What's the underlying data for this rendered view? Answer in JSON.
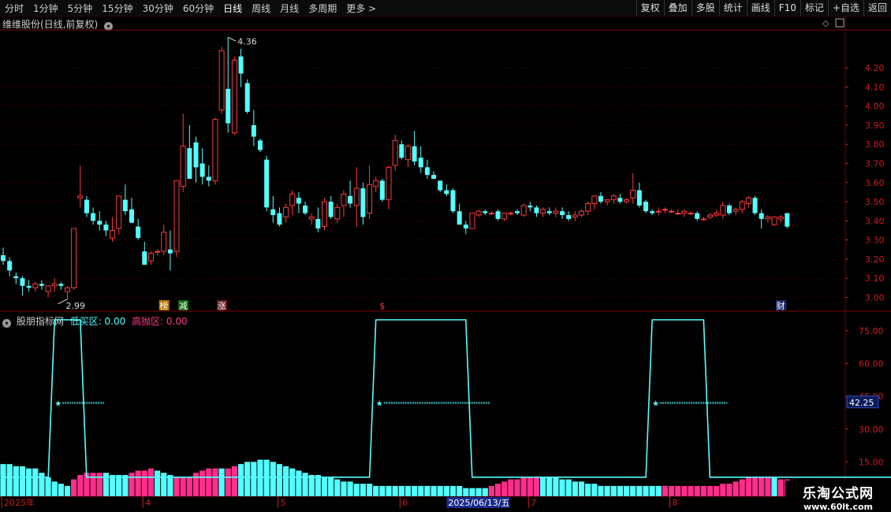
{
  "toolbar": {
    "timeframes": [
      "分时",
      "1分钟",
      "5分钟",
      "15分钟",
      "30分钟",
      "60分钟",
      "日线",
      "周线",
      "月线",
      "多周期",
      "更多 >"
    ],
    "active_timeframe": "日线",
    "right_buttons": [
      "复权",
      "叠加",
      "多股",
      "统计",
      "画线",
      "F10",
      "标记",
      "+自选",
      "返回"
    ]
  },
  "main_panel": {
    "title": "维维股份(日线,前复权)"
  },
  "indicator_panel": {
    "name": "股朋指标网",
    "low_label": "低买区: 0.00",
    "high_label": "高抛区: 0.00"
  },
  "watermark": {
    "title": "乐淘公式网",
    "url": "www.60lt.com"
  },
  "colors": {
    "up": "#ff3a3a",
    "down": "#54ffff",
    "bg": "#000000",
    "grid": "#7a0000",
    "axis_text": "#c8201e",
    "line": "#54ffff",
    "bar_pink": "#ff2e8a",
    "bar_cyan": "#54ffff"
  },
  "chart_data": [
    {
      "type": "candlestick",
      "y_ticks": [
        "4.20",
        "4.10",
        "4.00",
        "3.90",
        "3.80",
        "3.70",
        "3.60",
        "3.50",
        "3.40",
        "3.30",
        "3.20",
        "3.10",
        "3.00"
      ],
      "ylim": [
        2.94,
        4.39
      ],
      "annotations": {
        "high": "4.36",
        "low": "2.99"
      },
      "event_markers": [
        "榜",
        "减",
        "涨",
        "$",
        "财"
      ],
      "ohlc": [
        [
          3.22,
          3.26,
          3.17,
          3.19
        ],
        [
          3.19,
          3.21,
          3.11,
          3.14
        ],
        [
          3.11,
          3.13,
          3.07,
          3.1
        ],
        [
          3.1,
          3.11,
          3.01,
          3.06
        ],
        [
          3.06,
          3.09,
          3.03,
          3.05
        ],
        [
          3.05,
          3.08,
          3.03,
          3.07
        ],
        [
          3.07,
          3.09,
          3.04,
          3.06
        ],
        [
          3.03,
          3.06,
          3.0,
          3.06
        ],
        [
          3.06,
          3.1,
          3.03,
          3.07
        ],
        [
          3.07,
          3.08,
          3.04,
          3.06
        ],
        [
          3.03,
          3.06,
          2.99,
          3.05
        ],
        [
          3.05,
          3.36,
          3.04,
          3.36
        ],
        [
          3.52,
          3.69,
          3.47,
          3.53
        ],
        [
          3.51,
          3.53,
          3.42,
          3.44
        ],
        [
          3.44,
          3.47,
          3.38,
          3.4
        ],
        [
          3.4,
          3.45,
          3.35,
          3.38
        ],
        [
          3.38,
          3.4,
          3.32,
          3.35
        ],
        [
          3.31,
          3.42,
          3.29,
          3.35
        ],
        [
          3.36,
          3.53,
          3.33,
          3.53
        ],
        [
          3.51,
          3.59,
          3.43,
          3.45
        ],
        [
          3.46,
          3.52,
          3.39,
          3.39
        ],
        [
          3.37,
          3.41,
          3.3,
          3.31
        ],
        [
          3.24,
          3.29,
          3.18,
          3.17
        ],
        [
          3.19,
          3.24,
          3.17,
          3.23
        ],
        [
          3.24,
          3.25,
          3.22,
          3.24
        ],
        [
          3.24,
          3.38,
          3.22,
          3.34
        ],
        [
          3.25,
          3.35,
          3.14,
          3.23
        ],
        [
          3.24,
          3.61,
          3.21,
          3.61
        ],
        [
          3.58,
          3.96,
          3.55,
          3.79
        ],
        [
          3.78,
          3.9,
          3.62,
          3.62
        ],
        [
          3.81,
          3.84,
          3.6,
          3.68
        ],
        [
          3.7,
          3.78,
          3.59,
          3.63
        ],
        [
          3.63,
          3.69,
          3.58,
          3.61
        ],
        [
          3.61,
          3.94,
          3.59,
          3.93
        ],
        [
          3.98,
          4.31,
          3.96,
          4.29
        ],
        [
          4.09,
          4.36,
          3.86,
          3.91
        ],
        [
          3.86,
          4.26,
          3.85,
          4.24
        ],
        [
          4.26,
          4.3,
          4.1,
          4.17
        ],
        [
          4.12,
          4.14,
          3.96,
          3.97
        ],
        [
          3.9,
          3.98,
          3.79,
          3.84
        ],
        [
          3.82,
          3.83,
          3.76,
          3.77
        ],
        [
          3.72,
          3.74,
          3.45,
          3.47
        ],
        [
          3.46,
          3.53,
          3.39,
          3.43
        ],
        [
          3.44,
          3.47,
          3.37,
          3.38
        ],
        [
          3.42,
          3.49,
          3.39,
          3.47
        ],
        [
          3.48,
          3.56,
          3.43,
          3.54
        ],
        [
          3.52,
          3.55,
          3.44,
          3.49
        ],
        [
          3.48,
          3.5,
          3.43,
          3.44
        ],
        [
          3.41,
          3.44,
          3.38,
          3.42
        ],
        [
          3.41,
          3.47,
          3.34,
          3.36
        ],
        [
          3.37,
          3.52,
          3.35,
          3.5
        ],
        [
          3.5,
          3.53,
          3.41,
          3.42
        ],
        [
          3.41,
          3.49,
          3.39,
          3.47
        ],
        [
          3.48,
          3.56,
          3.42,
          3.54
        ],
        [
          3.53,
          3.61,
          3.47,
          3.49
        ],
        [
          3.48,
          3.68,
          3.37,
          3.57
        ],
        [
          3.57,
          3.6,
          3.38,
          3.42
        ],
        [
          3.44,
          3.69,
          3.41,
          3.59
        ],
        [
          3.58,
          3.63,
          3.55,
          3.61
        ],
        [
          3.61,
          3.62,
          3.5,
          3.51
        ],
        [
          3.51,
          3.69,
          3.46,
          3.68
        ],
        [
          3.69,
          3.85,
          3.66,
          3.82
        ],
        [
          3.8,
          3.82,
          3.72,
          3.73
        ],
        [
          3.72,
          3.8,
          3.68,
          3.79
        ],
        [
          3.79,
          3.87,
          3.69,
          3.71
        ],
        [
          3.73,
          3.79,
          3.65,
          3.68
        ],
        [
          3.68,
          3.72,
          3.62,
          3.64
        ],
        [
          3.64,
          3.66,
          3.62,
          3.62
        ],
        [
          3.61,
          3.61,
          3.55,
          3.56
        ],
        [
          3.56,
          3.59,
          3.53,
          3.54
        ],
        [
          3.56,
          3.57,
          3.44,
          3.45
        ],
        [
          3.45,
          3.49,
          3.38,
          3.38
        ],
        [
          3.38,
          3.4,
          3.33,
          3.36
        ],
        [
          3.36,
          3.44,
          3.36,
          3.44
        ],
        [
          3.43,
          3.46,
          3.42,
          3.45
        ],
        [
          3.45,
          3.46,
          3.43,
          3.44
        ],
        [
          3.44,
          3.45,
          3.43,
          3.44
        ],
        [
          3.45,
          3.46,
          3.4,
          3.41
        ],
        [
          3.41,
          3.44,
          3.4,
          3.44
        ],
        [
          3.44,
          3.45,
          3.43,
          3.44
        ],
        [
          3.45,
          3.46,
          3.43,
          3.44
        ],
        [
          3.43,
          3.49,
          3.42,
          3.48
        ],
        [
          3.48,
          3.5,
          3.45,
          3.47
        ],
        [
          3.47,
          3.48,
          3.42,
          3.44
        ],
        [
          3.44,
          3.47,
          3.42,
          3.46
        ],
        [
          3.45,
          3.47,
          3.43,
          3.44
        ],
        [
          3.44,
          3.47,
          3.42,
          3.45
        ],
        [
          3.45,
          3.47,
          3.41,
          3.43
        ],
        [
          3.43,
          3.45,
          3.4,
          3.41
        ],
        [
          3.42,
          3.45,
          3.4,
          3.43
        ],
        [
          3.43,
          3.46,
          3.42,
          3.45
        ],
        [
          3.45,
          3.5,
          3.43,
          3.49
        ],
        [
          3.49,
          3.53,
          3.46,
          3.53
        ],
        [
          3.53,
          3.55,
          3.49,
          3.5
        ],
        [
          3.5,
          3.51,
          3.48,
          3.51
        ],
        [
          3.51,
          3.54,
          3.49,
          3.53
        ],
        [
          3.52,
          3.54,
          3.49,
          3.5
        ],
        [
          3.5,
          3.52,
          3.49,
          3.51
        ],
        [
          3.52,
          3.65,
          3.49,
          3.56
        ],
        [
          3.56,
          3.6,
          3.47,
          3.48
        ],
        [
          3.5,
          3.51,
          3.44,
          3.45
        ],
        [
          3.45,
          3.46,
          3.43,
          3.44
        ],
        [
          3.45,
          3.47,
          3.43,
          3.45
        ],
        [
          3.46,
          3.47,
          3.44,
          3.46
        ],
        [
          3.45,
          3.46,
          3.44,
          3.45
        ],
        [
          3.44,
          3.46,
          3.43,
          3.44
        ],
        [
          3.44,
          3.46,
          3.42,
          3.45
        ],
        [
          3.44,
          3.45,
          3.43,
          3.44
        ],
        [
          3.44,
          3.45,
          3.4,
          3.41
        ],
        [
          3.41,
          3.42,
          3.4,
          3.41
        ],
        [
          3.42,
          3.44,
          3.41,
          3.43
        ],
        [
          3.43,
          3.46,
          3.42,
          3.44
        ],
        [
          3.43,
          3.5,
          3.41,
          3.48
        ],
        [
          3.48,
          3.49,
          3.43,
          3.44
        ],
        [
          3.45,
          3.47,
          3.43,
          3.46
        ],
        [
          3.46,
          3.51,
          3.44,
          3.5
        ],
        [
          3.49,
          3.53,
          3.47,
          3.52
        ],
        [
          3.52,
          3.53,
          3.43,
          3.44
        ],
        [
          3.44,
          3.46,
          3.36,
          3.41
        ],
        [
          3.41,
          3.43,
          3.39,
          3.42
        ],
        [
          3.38,
          3.42,
          3.37,
          3.42
        ],
        [
          3.41,
          3.43,
          3.39,
          3.42
        ],
        [
          3.44,
          3.44,
          3.36,
          3.37
        ]
      ]
    },
    {
      "type": "line+bar",
      "y_ticks": [
        "75.00",
        "60.00",
        "45.00",
        "30.00",
        "15.00"
      ],
      "ylim": [
        0,
        80
      ],
      "current_value": "42.25",
      "line_plateau": 80,
      "line_floor": 8,
      "star_label_level": 42,
      "plateaus": [
        [
          8,
          12
        ],
        [
          58,
          72
        ],
        [
          101,
          109
        ],
        [
          145,
          155
        ]
      ],
      "bars": [
        14,
        14,
        13,
        13,
        12,
        12,
        10,
        8,
        6,
        5,
        4,
        7,
        9,
        10,
        10,
        10,
        10,
        9,
        9,
        9,
        10,
        11,
        11,
        12,
        11,
        10,
        9,
        8,
        8,
        8,
        10,
        11,
        12,
        12,
        12,
        12,
        13,
        14,
        15,
        15,
        16,
        16,
        15,
        14,
        13,
        12,
        11,
        10,
        9,
        9,
        8,
        8,
        7,
        6,
        6,
        5,
        5,
        5,
        4,
        4,
        4,
        4,
        4,
        4,
        4,
        4,
        4,
        4,
        4,
        4,
        4,
        4,
        3,
        3,
        3,
        3,
        4,
        5,
        6,
        7,
        7,
        8,
        8,
        8,
        8,
        8,
        8,
        7,
        7,
        6,
        6,
        5,
        5,
        4,
        4,
        4,
        4,
        4,
        4,
        4,
        4,
        4,
        4,
        4,
        4,
        4,
        4,
        4,
        4,
        4,
        4,
        4,
        5,
        5,
        6,
        7,
        8,
        8,
        8,
        8,
        8,
        7,
        7,
        6,
        6,
        5,
        5,
        4,
        4,
        4,
        4,
        4,
        4,
        3,
        3,
        3,
        3,
        3,
        3,
        3,
        3,
        3,
        3,
        3,
        3,
        3,
        4,
        4,
        4,
        4,
        4,
        4,
        4,
        4,
        3,
        3,
        3,
        3,
        3
      ],
      "bar_colors": [
        "c",
        "c",
        "c",
        "c",
        "c",
        "c",
        "c",
        "c",
        "c",
        "c",
        "c",
        "p",
        "p",
        "p",
        "p",
        "p",
        "c",
        "c",
        "c",
        "c",
        "p",
        "p",
        "p",
        "p",
        "c",
        "c",
        "c",
        "p",
        "p",
        "p",
        "p",
        "p",
        "p",
        "p",
        "c",
        "p",
        "p",
        "c",
        "c",
        "c",
        "c",
        "c",
        "c",
        "c",
        "c",
        "c",
        "c",
        "c",
        "c",
        "c",
        "c",
        "c",
        "c",
        "c",
        "c",
        "c",
        "c",
        "c",
        "c",
        "c",
        "c",
        "c",
        "c",
        "c",
        "c",
        "c",
        "c",
        "c",
        "c",
        "c",
        "c",
        "c",
        "c",
        "c",
        "c",
        "c",
        "p",
        "p",
        "p",
        "p",
        "p",
        "p",
        "p",
        "p",
        "c",
        "c",
        "c",
        "c",
        "c",
        "c",
        "c",
        "c",
        "c",
        "c",
        "c",
        "c",
        "c",
        "c",
        "c",
        "c",
        "c",
        "c",
        "c",
        "p",
        "p",
        "p",
        "p",
        "p",
        "p",
        "p",
        "p",
        "p",
        "p",
        "p",
        "p",
        "p",
        "p",
        "p",
        "p",
        "p",
        "c",
        "p",
        "p",
        "p",
        "c",
        "c",
        "c",
        "c",
        "c",
        "c",
        "c",
        "c",
        "c",
        "c",
        "c",
        "c",
        "c",
        "c",
        "c",
        "c",
        "c",
        "c",
        "c",
        "c",
        "p",
        "p",
        "p"
      ]
    }
  ],
  "time_axis": {
    "labels": [
      "2025年",
      "4",
      "5",
      "6",
      "7",
      "8"
    ],
    "cursor_date": "2025/06/13/五"
  }
}
